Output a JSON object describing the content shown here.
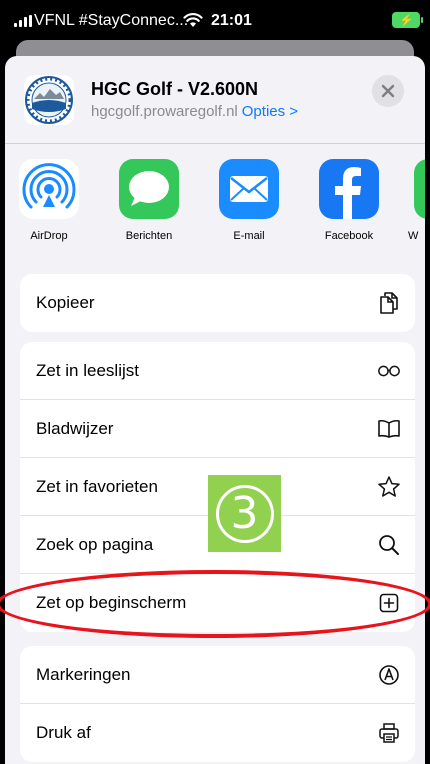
{
  "status_bar": {
    "carrier": "VFNL #StayConnec...",
    "time": "21:01",
    "battery_bolt": "⚡"
  },
  "share_sheet": {
    "title": "HGC Golf - V2.600N",
    "domain": "hgcgolf.prowaregolf.nl",
    "options_label": "Opties >",
    "close_icon": "×"
  },
  "apps": [
    {
      "label": "AirDrop",
      "icon": "airdrop-icon",
      "color": "#ffffff"
    },
    {
      "label": "Berichten",
      "icon": "messages-icon",
      "color": "#34c759"
    },
    {
      "label": "E-mail",
      "icon": "mail-icon",
      "color": "#1a8cff"
    },
    {
      "label": "Facebook",
      "icon": "facebook-icon",
      "color": "#1877f2"
    },
    {
      "label": "W",
      "icon": "whatsapp-icon",
      "color": "#34c759"
    }
  ],
  "actions": {
    "copy": {
      "label": "Kopieer",
      "icon": "copy-icon"
    },
    "reading_list": {
      "label": "Zet in leeslijst",
      "icon": "glasses-icon"
    },
    "bookmark": {
      "label": "Bladwijzer",
      "icon": "book-icon"
    },
    "favorites": {
      "label": "Zet in favorieten",
      "icon": "star-icon"
    },
    "find": {
      "label": "Zoek op pagina",
      "icon": "magnifier-icon"
    },
    "home_screen": {
      "label": "Zet op beginscherm",
      "icon": "add-square-icon"
    },
    "markup": {
      "label": "Markeringen",
      "icon": "markup-icon"
    },
    "print": {
      "label": "Druk af",
      "icon": "printer-icon"
    }
  },
  "annotation": {
    "step_number": "3",
    "badge_color": "#92d050",
    "ring_color": "#e8141b"
  }
}
